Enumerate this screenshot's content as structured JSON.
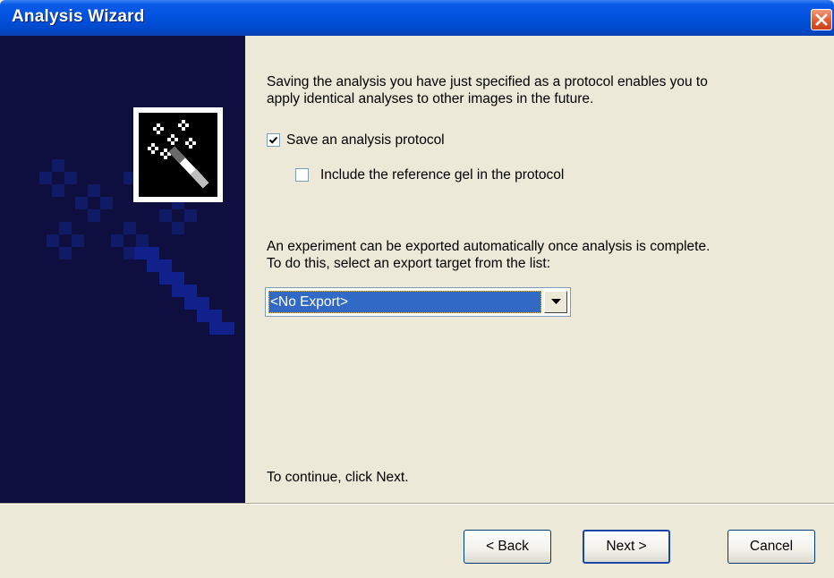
{
  "window": {
    "title": "Analysis Wizard"
  },
  "icons": {
    "close": "close-icon",
    "wand": "magic-wand-icon",
    "dropdown_arrow": "chevron-down-icon"
  },
  "content": {
    "intro_line1": "Saving the analysis you have just specified as a protocol enables you to",
    "intro_line2": "apply identical analyses to other images in the future.",
    "save_protocol": {
      "label": "Save an analysis protocol",
      "checked": true
    },
    "include_reference": {
      "label": "Include the reference gel in the protocol",
      "checked": false
    },
    "export_line1": "An experiment can be exported automatically once analysis is complete.",
    "export_line2": "To do this, select an export target from the list:",
    "export_target": {
      "selected": "<No Export>"
    },
    "continue_text": "To continue, click Next."
  },
  "footer": {
    "back_label": "< Back",
    "next_label": "Next >",
    "cancel_label": "Cancel"
  },
  "colors": {
    "titlebar": "#0052de",
    "banner": "#0e0e3f",
    "selection": "#316ac5",
    "dialog_bg": "#ece9d8"
  }
}
